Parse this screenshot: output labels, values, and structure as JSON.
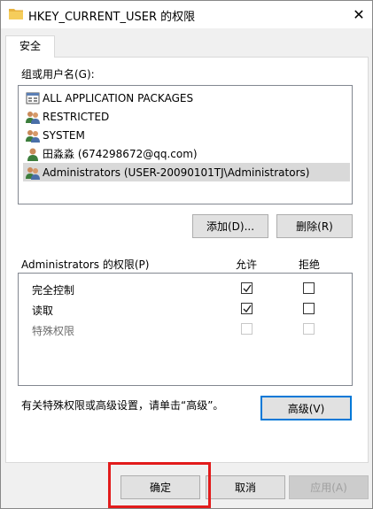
{
  "window": {
    "title": "HKEY_CURRENT_USER 的权限",
    "close_glyph": "✕"
  },
  "tab": {
    "label": "安全"
  },
  "groups": {
    "label": "组或用户名(G):",
    "items": [
      {
        "label": "ALL APPLICATION PACKAGES",
        "icon": "app-packages-icon"
      },
      {
        "label": "RESTRICTED",
        "icon": "group-icon"
      },
      {
        "label": "SYSTEM",
        "icon": "group-icon"
      },
      {
        "label": "田淼淼 (674298672@qq.com)",
        "icon": "user-icon"
      },
      {
        "label": "Administrators (USER-20090101TJ\\Administrators)",
        "icon": "group-icon",
        "selected": true
      }
    ]
  },
  "buttons": {
    "add": "添加(D)...",
    "remove": "删除(R)",
    "advanced": "高级(V)",
    "ok": "确定",
    "cancel": "取消",
    "apply": "应用(A)"
  },
  "permissions": {
    "label": "Administrators 的权限(P)",
    "allow_header": "允许",
    "deny_header": "拒绝",
    "rows": [
      {
        "name": "完全控制",
        "allow": true,
        "deny": false,
        "enabled": true
      },
      {
        "name": "读取",
        "allow": true,
        "deny": false,
        "enabled": true
      },
      {
        "name": "特殊权限",
        "allow": false,
        "deny": false,
        "enabled": false
      }
    ]
  },
  "advanced_hint": "有关特殊权限或高级设置，请单击“高级”。",
  "colors": {
    "accent": "#0078d7",
    "highlight": "#e21b1b",
    "selection": "#d9d9d9"
  }
}
